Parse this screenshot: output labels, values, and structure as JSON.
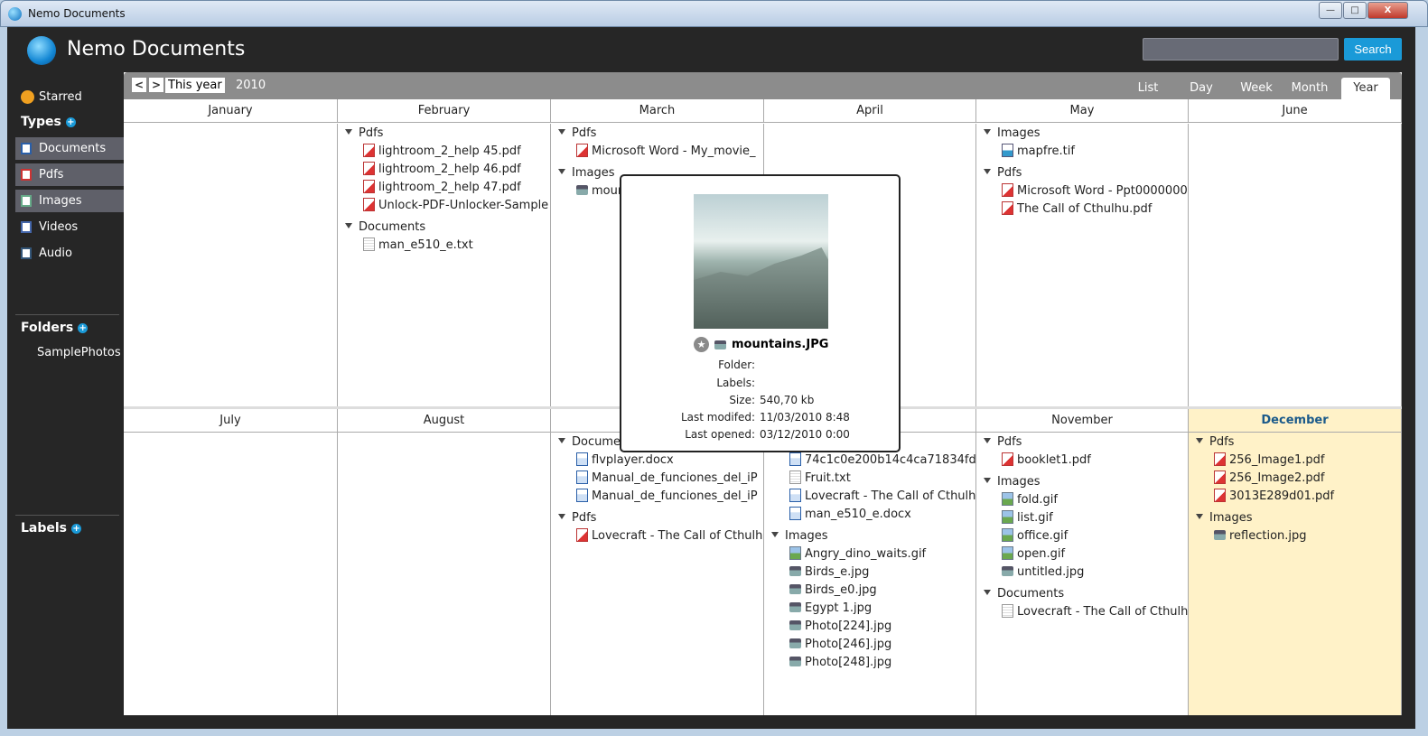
{
  "window": {
    "title": "Nemo Documents",
    "minimize": "—",
    "maximize": "□",
    "close": "X"
  },
  "app": {
    "title": "Nemo Documents"
  },
  "search": {
    "placeholder": "",
    "button": "Search"
  },
  "sidebar": {
    "starred": "Starred",
    "types_title": "Types",
    "types": [
      {
        "label": "Documents",
        "icon": "word-doc-icon",
        "selected": true
      },
      {
        "label": "Pdfs",
        "icon": "pdf-icon",
        "selected": true
      },
      {
        "label": "Images",
        "icon": "image-icon",
        "selected": true
      },
      {
        "label": "Videos",
        "icon": "video-icon",
        "selected": false
      },
      {
        "label": "Audio",
        "icon": "audio-icon",
        "selected": false
      }
    ],
    "folders_title": "Folders",
    "folders": [
      "SamplePhotos"
    ],
    "labels_title": "Labels"
  },
  "toolbar": {
    "prev": "<",
    "next": ">",
    "this_year": "This year",
    "year": "2010",
    "tabs": [
      "List",
      "Day",
      "Week",
      "Month",
      "Year"
    ],
    "active_tab": "Year"
  },
  "months": [
    {
      "name": "January",
      "groups": []
    },
    {
      "name": "February",
      "groups": [
        {
          "label": "Pdfs",
          "items": [
            [
              "pdf",
              "lightroom_2_help 45.pdf"
            ],
            [
              "pdf",
              "lightroom_2_help 46.pdf"
            ],
            [
              "pdf",
              "lightroom_2_help 47.pdf"
            ],
            [
              "pdf",
              "Unlock-PDF-Unlocker-Sample"
            ]
          ]
        },
        {
          "label": "Documents",
          "items": [
            [
              "txt",
              "man_e510_e.txt"
            ]
          ]
        }
      ]
    },
    {
      "name": "March",
      "groups": [
        {
          "label": "Pdfs",
          "items": [
            [
              "pdf",
              "Microsoft Word - My_movie_"
            ]
          ]
        },
        {
          "label": "Images",
          "items": [
            [
              "jpg",
              "mountains.JPG"
            ]
          ]
        }
      ]
    },
    {
      "name": "April",
      "groups": []
    },
    {
      "name": "May",
      "groups": [
        {
          "label": "Images",
          "items": [
            [
              "tif",
              "mapfre.tif"
            ]
          ]
        },
        {
          "label": "Pdfs",
          "items": [
            [
              "pdf",
              "Microsoft Word - Ppt0000000"
            ],
            [
              "pdf",
              "The Call of Cthulhu.pdf"
            ]
          ]
        }
      ]
    },
    {
      "name": "June",
      "groups": []
    },
    {
      "name": "July",
      "groups": []
    },
    {
      "name": "August",
      "groups": []
    },
    {
      "name": "",
      "groups": [
        {
          "label": "Documents",
          "items": [
            [
              "doc",
              "flvplayer.docx"
            ],
            [
              "doc",
              "Manual_de_funciones_del_iP"
            ],
            [
              "doc",
              "Manual_de_funciones_del_iP"
            ]
          ]
        },
        {
          "label": "Pdfs",
          "items": [
            [
              "pdf",
              "Lovecraft - The Call of Cthulh"
            ]
          ]
        }
      ]
    },
    {
      "name": "",
      "groups": [
        {
          "label": "",
          "items": [
            [
              "doc",
              "74c1c0e200b14c4ca71834fd"
            ],
            [
              "txt",
              "Fruit.txt"
            ],
            [
              "doc",
              "Lovecraft - The Call of Cthulh"
            ],
            [
              "doc",
              "man_e510_e.docx"
            ]
          ]
        },
        {
          "label": "Images",
          "items": [
            [
              "img",
              "Angry_dino_waits.gif"
            ],
            [
              "jpg",
              "Birds_e.jpg"
            ],
            [
              "jpg",
              "Birds_e0.jpg"
            ],
            [
              "jpg",
              "Egypt 1.jpg"
            ],
            [
              "jpg",
              "Photo[224].jpg"
            ],
            [
              "jpg",
              "Photo[246].jpg"
            ],
            [
              "jpg",
              "Photo[248].jpg"
            ]
          ]
        }
      ]
    },
    {
      "name": "November",
      "groups": [
        {
          "label": "Pdfs",
          "items": [
            [
              "pdf",
              "booklet1.pdf"
            ]
          ]
        },
        {
          "label": "Images",
          "items": [
            [
              "img",
              "fold.gif"
            ],
            [
              "img",
              "list.gif"
            ],
            [
              "img",
              "office.gif"
            ],
            [
              "img",
              "open.gif"
            ],
            [
              "jpg",
              "untitled.jpg"
            ]
          ]
        },
        {
          "label": "Documents",
          "items": [
            [
              "txt",
              "Lovecraft - The Call of Cthulh"
            ]
          ]
        }
      ]
    },
    {
      "name": "December",
      "highlight": true,
      "groups": [
        {
          "label": "Pdfs",
          "items": [
            [
              "pdf",
              "256_Image1.pdf"
            ],
            [
              "pdf",
              "256_Image2.pdf"
            ],
            [
              "pdf",
              "3013E289d01.pdf"
            ]
          ]
        },
        {
          "label": "Images",
          "items": [
            [
              "jpg",
              "reflection.jpg"
            ]
          ]
        }
      ]
    }
  ],
  "popup": {
    "name": "mountains.JPG",
    "folder_label": "Folder:",
    "folder": "",
    "labels_label": "Labels:",
    "labels": "",
    "size_label": "Size:",
    "size": "540,70 kb",
    "modified_label": "Last modifed:",
    "modified": "11/03/2010 8:48",
    "opened_label": "Last opened:",
    "opened": "03/12/2010 0:00"
  },
  "colors": {
    "accent": "#1a9ad8",
    "highlight": "#fff2c8",
    "background": "#262626"
  }
}
